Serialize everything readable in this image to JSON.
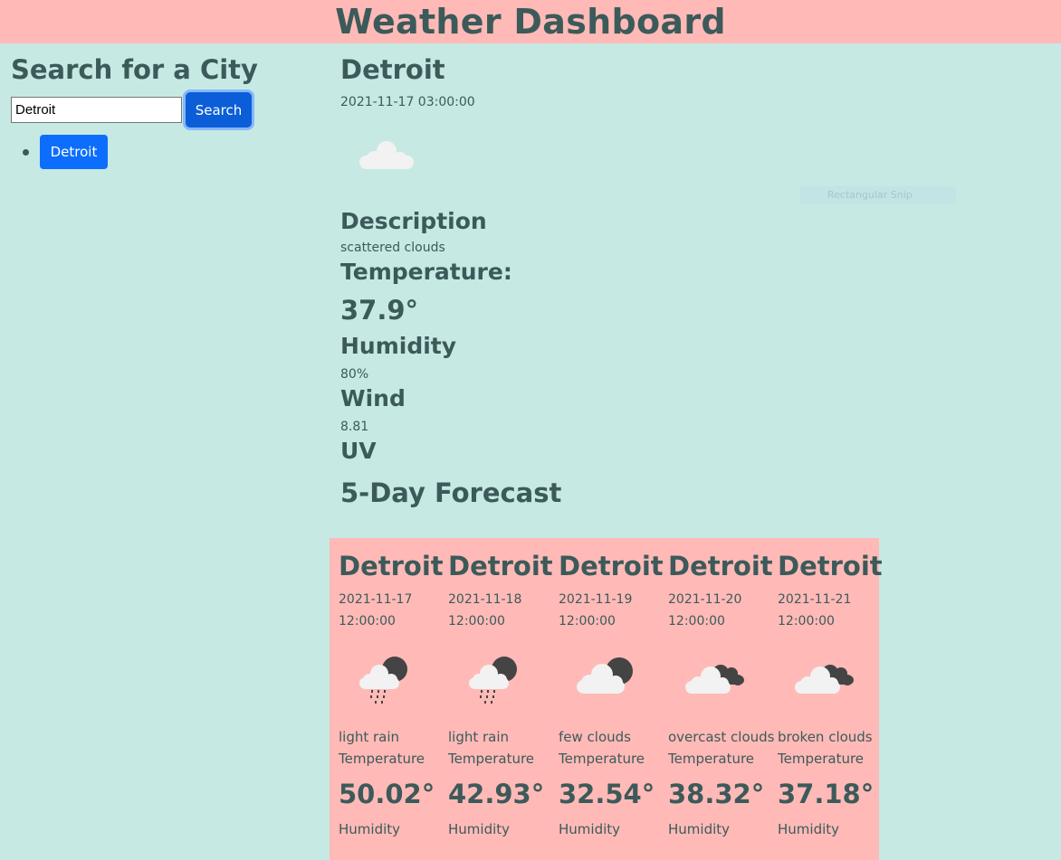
{
  "header": {
    "title": "Weather Dashboard"
  },
  "sidebar": {
    "title": "Search for a City",
    "search": {
      "value": "Detroit",
      "button_label": "Search"
    },
    "history": [
      {
        "label": "Detroit"
      }
    ]
  },
  "current": {
    "city": "Detroit",
    "datetime": "2021-11-17 03:00:00",
    "icon": "scattered-clouds-icon",
    "description_label": "Description",
    "description": "scattered clouds",
    "temperature_label": "Temperature:",
    "temperature": "37.9°",
    "humidity_label": "Humidity",
    "humidity": "80%",
    "wind_label": "Wind",
    "wind": "8.81",
    "uv_label": "UV"
  },
  "forecast": {
    "title": "5-Day Forecast",
    "days": [
      {
        "city": "Detroit",
        "date": "2021-11-17",
        "time": "12:00:00",
        "icon": "light-rain-icon",
        "description": "light rain",
        "temp_label": "Temperature",
        "temp": "50.02°",
        "humidity_label": "Humidity"
      },
      {
        "city": "Detroit",
        "date": "2021-11-18",
        "time": "12:00:00",
        "icon": "light-rain-icon",
        "description": "light rain",
        "temp_label": "Temperature",
        "temp": "42.93°",
        "humidity_label": "Humidity"
      },
      {
        "city": "Detroit",
        "date": "2021-11-19",
        "time": "12:00:00",
        "icon": "few-clouds-icon",
        "description": "few clouds",
        "temp_label": "Temperature",
        "temp": "32.54°",
        "humidity_label": "Humidity"
      },
      {
        "city": "Detroit",
        "date": "2021-11-20",
        "time": "12:00:00",
        "icon": "overcast-clouds-icon",
        "description": "overcast clouds",
        "temp_label": "Temperature",
        "temp": "38.32°",
        "humidity_label": "Humidity"
      },
      {
        "city": "Detroit",
        "date": "2021-11-21",
        "time": "12:00:00",
        "icon": "broken-clouds-icon",
        "description": "broken clouds",
        "temp_label": "Temperature",
        "temp": "37.18°",
        "humidity_label": "Humidity"
      }
    ]
  },
  "overlay": {
    "label": "Rectangular Snip"
  },
  "colors": {
    "header_bg": "#ffbab7",
    "page_bg": "#c6e9e3",
    "text": "#3c5a5a",
    "primary": "#0d6efd"
  }
}
